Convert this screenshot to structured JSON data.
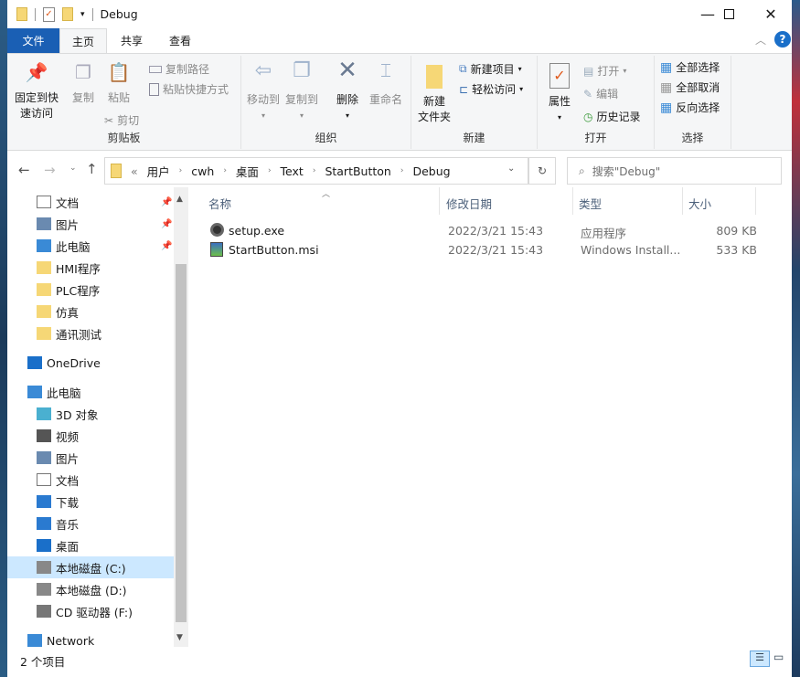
{
  "window": {
    "title": "Debug"
  },
  "tabs": [
    {
      "label": "文件",
      "active": false
    },
    {
      "label": "主页",
      "active": true
    },
    {
      "label": "共享",
      "active": false
    },
    {
      "label": "查看",
      "active": false
    }
  ],
  "ribbon": {
    "clipboard": {
      "label": "剪贴板",
      "pin": "固定到快",
      "pin2": "速访问",
      "copy": "复制",
      "paste": "粘贴",
      "copy_path": "复制路径",
      "paste_shortcut": "粘贴快捷方式",
      "cut": "剪切"
    },
    "organize": {
      "label": "组织",
      "move_to": "移动到",
      "copy_to": "复制到",
      "delete": "删除",
      "rename": "重命名"
    },
    "new": {
      "label": "新建",
      "new_folder": "新建",
      "new_folder2": "文件夹",
      "new_item": "新建项目",
      "easy_access": "轻松访问"
    },
    "open": {
      "label": "打开",
      "properties": "属性",
      "open": "打开",
      "edit": "编辑",
      "history": "历史记录"
    },
    "select": {
      "label": "选择",
      "select_all": "全部选择",
      "select_none": "全部取消",
      "invert": "反向选择"
    }
  },
  "address": {
    "crumbs": [
      "用户",
      "cwh",
      "桌面",
      "Text",
      "StartButton",
      "Debug"
    ],
    "overflow": "«"
  },
  "search": {
    "placeholder": "搜索\"Debug\""
  },
  "sidebar": {
    "items": [
      {
        "label": "文档",
        "icon": "document-icon",
        "pinned": true
      },
      {
        "label": "图片",
        "icon": "pictures-icon",
        "pinned": true
      },
      {
        "label": "此电脑",
        "icon": "computer-icon",
        "pinned": true
      },
      {
        "label": "HMI程序",
        "icon": "folder-icon"
      },
      {
        "label": "PLC程序",
        "icon": "folder-icon"
      },
      {
        "label": "仿真",
        "icon": "folder-icon"
      },
      {
        "label": "通讯测试",
        "icon": "folder-icon"
      },
      {
        "label": "OneDrive",
        "icon": "cloud-icon"
      },
      {
        "label": "此电脑",
        "icon": "computer-icon"
      },
      {
        "label": "3D 对象",
        "icon": "3d-objects-icon"
      },
      {
        "label": "视频",
        "icon": "videos-icon"
      },
      {
        "label": "图片",
        "icon": "pictures-icon"
      },
      {
        "label": "文档",
        "icon": "document-icon"
      },
      {
        "label": "下载",
        "icon": "download-icon"
      },
      {
        "label": "音乐",
        "icon": "music-icon"
      },
      {
        "label": "桌面",
        "icon": "desktop-icon"
      },
      {
        "label": "本地磁盘 (C:)",
        "icon": "drive-icon",
        "selected": true
      },
      {
        "label": "本地磁盘 (D:)",
        "icon": "drive-icon"
      },
      {
        "label": "CD 驱动器 (F:)",
        "icon": "cd-drive-icon"
      },
      {
        "label": "Network",
        "icon": "network-icon"
      }
    ]
  },
  "columns": [
    "名称",
    "修改日期",
    "类型",
    "大小"
  ],
  "files": [
    {
      "name": "setup.exe",
      "date": "2022/3/21 15:43",
      "type": "应用程序",
      "size": "809 KB",
      "icon": "setup-exe-icon"
    },
    {
      "name": "StartButton.msi",
      "date": "2022/3/21 15:43",
      "type": "Windows Install...",
      "size": "533 KB",
      "icon": "msi-installer-icon"
    }
  ],
  "status": {
    "count": "2 个项目"
  },
  "colors": {
    "file_tab": "#1a5fb4",
    "accent": "#0063b1",
    "selected": "#cce8ff"
  }
}
